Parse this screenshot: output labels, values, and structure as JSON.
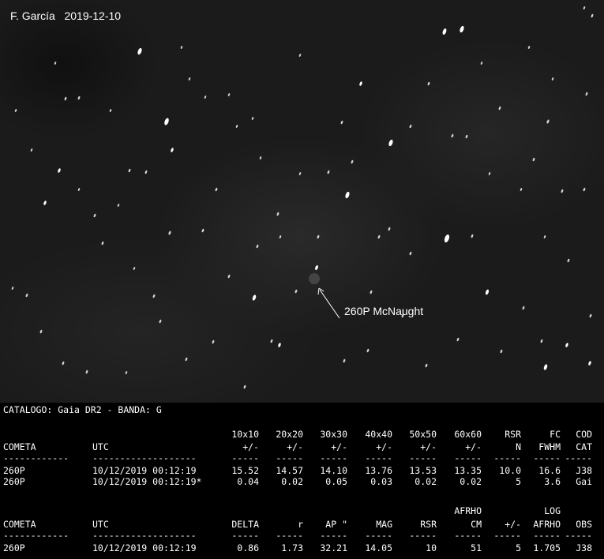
{
  "image": {
    "caption": "F. García   2019-12-10",
    "target_label": "260P McNaught"
  },
  "report": {
    "catalog_line": "CATALOGO: Gaia DR2 - BANDA: G",
    "table1": {
      "header_top": [
        "",
        "",
        "10x10",
        "20x20",
        "30x30",
        "40x40",
        "50x50",
        "60x60",
        "RSR",
        "FC",
        "COD"
      ],
      "header": [
        "COMETA",
        "UTC",
        "+/-",
        "+/-",
        "+/-",
        "+/-",
        "+/-",
        "+/-",
        "N",
        "FWHM",
        "CAT"
      ],
      "rows": [
        [
          "260P",
          "10/12/2019 00:12:19",
          "15.52",
          "14.57",
          "14.10",
          "13.76",
          "13.53",
          "13.35",
          "10.0",
          "16.6",
          "J38"
        ],
        [
          "260P",
          "10/12/2019 00:12:19*",
          "0.04",
          "0.02",
          "0.05",
          "0.03",
          "0.02",
          "0.02",
          "5",
          "3.6",
          "Gai"
        ]
      ]
    },
    "table2": {
      "header_top": [
        "",
        "",
        "",
        "",
        "",
        "",
        "",
        "AFRHO",
        "",
        "LOG",
        ""
      ],
      "header": [
        "COMETA",
        "UTC",
        "DELTA",
        "r",
        "AP \"",
        "MAG",
        "RSR",
        "CM",
        "+/-",
        "AFRHO",
        "OBS"
      ],
      "rows": [
        [
          "260P",
          "10/12/2019 00:12:19",
          "0.86",
          "1.73",
          "32.21",
          "14.05",
          "10",
          "51",
          "5",
          "1.705",
          "J38"
        ]
      ]
    }
  }
}
